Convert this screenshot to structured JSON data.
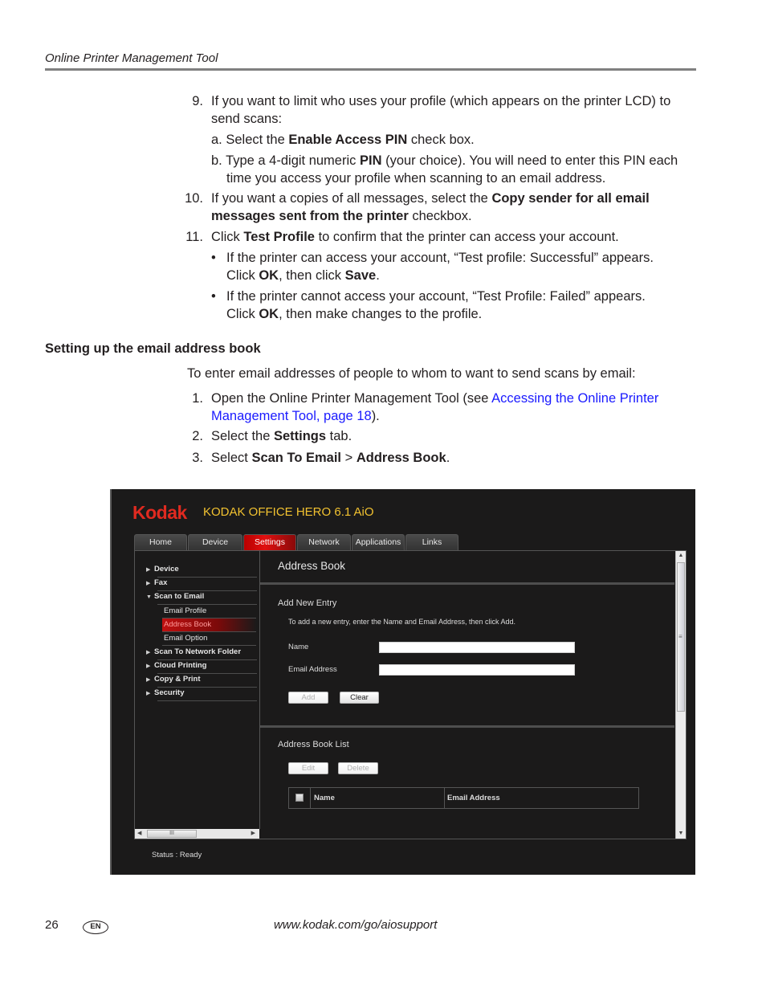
{
  "header": {
    "running_title": "Online Printer Management Tool"
  },
  "steps_continued": [
    {
      "number": "9.",
      "text_parts": [
        "If you want to limit who uses your profile (which appears on the printer LCD) to",
        "send scans:"
      ]
    },
    {
      "sub": "a.",
      "pre": "Select the ",
      "bold": "Enable Access PIN",
      "post": " check box."
    },
    {
      "sub": "b.",
      "pre": "Type a 4-digit numeric ",
      "bold": "PIN",
      "post": " (your choice). You will need to enter this PIN each",
      "line2": "time you access your profile when scanning to an email address."
    },
    {
      "number": "10.",
      "pre": "If you want a copies of all messages, select the ",
      "bold": "Copy sender for all email",
      "line2_bold": "messages sent from the printer",
      "line2_post": " checkbox."
    },
    {
      "number": "11.",
      "pre": "Click ",
      "bold": "Test Profile",
      "post": " to confirm that the printer can access your account."
    }
  ],
  "bullets": [
    {
      "line1": "If the printer can access your account, “Test profile: Successful” appears.",
      "l2_pre": "Click ",
      "l2_bold1": "OK",
      "l2_mid": ", then click ",
      "l2_bold2": "Save",
      "l2_post": "."
    },
    {
      "line1": "If the printer cannot access your account, “Test Profile: Failed” appears.",
      "l2_pre": "Click ",
      "l2_bold1": "OK",
      "l2_mid": ", then make changes to the profile.",
      "l2_bold2": "",
      "l2_post": ""
    }
  ],
  "section": {
    "heading": "Setting up the email address book",
    "intro": "To enter email addresses of people to whom to want to send scans by email:",
    "steps": [
      {
        "number": "1.",
        "pre": "Open the Online Printer Management Tool (see ",
        "link_line1": "Accessing the Online Printer",
        "link_line2": "Management Tool, page 18",
        "post": ")."
      },
      {
        "number": "2.",
        "pre": "Select the ",
        "bold": "Settings",
        "post": " tab."
      },
      {
        "number": "3.",
        "pre": "Select ",
        "bold": "Scan To Email",
        "mid": " > ",
        "bold2": "Address Book",
        "post": "."
      }
    ]
  },
  "screenshot": {
    "logo": "Kodak",
    "product": "KODAK OFFICE HERO 6.1 AiO",
    "tabs": [
      "Home",
      "Device",
      "Settings",
      "Network",
      "Applications",
      "Links"
    ],
    "active_tab": "Settings",
    "sidebar": {
      "items": [
        {
          "label": "Device",
          "icon": "triangle-right"
        },
        {
          "label": "Fax",
          "icon": "triangle-right"
        },
        {
          "label": "Scan to Email",
          "icon": "triangle-down"
        },
        {
          "label": "Scan To Network Folder",
          "icon": "triangle-right"
        },
        {
          "label": "Cloud Printing",
          "icon": "triangle-right"
        },
        {
          "label": "Copy & Print",
          "icon": "triangle-right"
        },
        {
          "label": "Security",
          "icon": "triangle-right"
        }
      ],
      "subitems": [
        "Email Profile",
        "Address Book",
        "Email Option"
      ],
      "active_subitem": "Address Book"
    },
    "main": {
      "title": "Address Book",
      "add_section_title": "Add New Entry",
      "add_hint": "To add a new entry, enter the Name and Email Address, then click Add.",
      "name_label": "Name",
      "name_value": "",
      "email_label": "Email Address",
      "email_value": "",
      "add_button": "Add",
      "clear_button": "Clear",
      "list_section_title": "Address Book List",
      "edit_button": "Edit",
      "delete_button": "Delete",
      "columns": [
        "Name",
        "Email Address"
      ]
    },
    "scroll_grip": "III",
    "status": "Status : Ready",
    "colors": {
      "brand_red": "#e02a20",
      "product_yellow": "#f2c230",
      "active_red": "#d01010",
      "background": "#1b1a1a"
    }
  },
  "footer": {
    "page_number": "26",
    "language": "EN",
    "url": "www.kodak.com/go/aiosupport"
  }
}
